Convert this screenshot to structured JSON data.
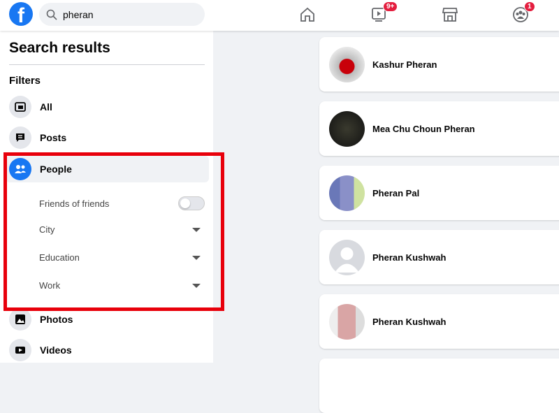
{
  "header": {
    "search_value": "pheran",
    "nav": [
      {
        "name": "home",
        "badge": ""
      },
      {
        "name": "watch",
        "badge": "9+"
      },
      {
        "name": "marketplace",
        "badge": ""
      },
      {
        "name": "groups",
        "badge": "1"
      }
    ]
  },
  "sidebar": {
    "title": "Search results",
    "filters_label": "Filters",
    "items": [
      {
        "label": "All"
      },
      {
        "label": "Posts"
      },
      {
        "label": "People"
      },
      {
        "label": "Photos"
      },
      {
        "label": "Videos"
      }
    ],
    "people_filters": {
      "friends_of_friends": "Friends of friends",
      "friends_of_friends_on": false,
      "city": "City",
      "education": "Education",
      "work": "Work"
    }
  },
  "results": [
    {
      "name": "Kashur Pheran"
    },
    {
      "name": "Mea Chu Choun Pheran"
    },
    {
      "name": "Pheran Pal"
    },
    {
      "name": "Pheran Kushwah"
    },
    {
      "name": "Pheran Kushwah"
    }
  ],
  "colors": {
    "accent": "#1877f2",
    "highlight": "#e8000b",
    "badge": "#e41e3f"
  }
}
